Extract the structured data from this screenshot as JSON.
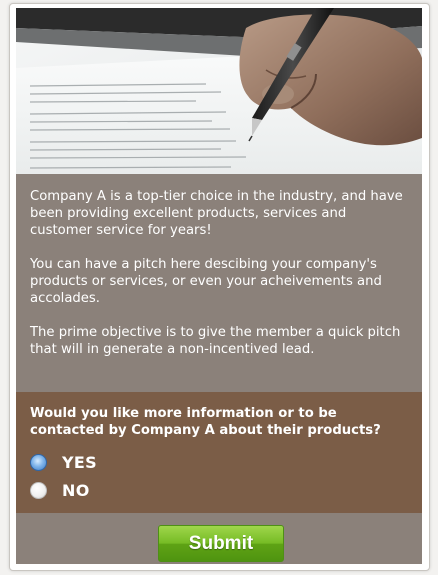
{
  "hero": {
    "image_description": ""
  },
  "pitch": {
    "paragraphs": [
      "Company A is a top-tier choice in the industry, and have been providing excellent products, services and customer service for years!",
      "You can have a pitch here descibing your company's products or services, or even your acheivements and accolades.",
      "The prime objective is to give the member a quick pitch that will in generate a non-incentived lead."
    ]
  },
  "question": {
    "text": "Would you like more information or to be contacted by Company A about their products?",
    "options": [
      {
        "label": "YES",
        "selected": true
      },
      {
        "label": "NO",
        "selected": false
      }
    ]
  },
  "footer": {
    "submit_label": "Submit"
  },
  "colors": {
    "pitch_bg": "#8b817a",
    "question_bg": "#7b5d47",
    "submit_green": "#75bb24",
    "radio_selected": "#3f7cc4"
  }
}
